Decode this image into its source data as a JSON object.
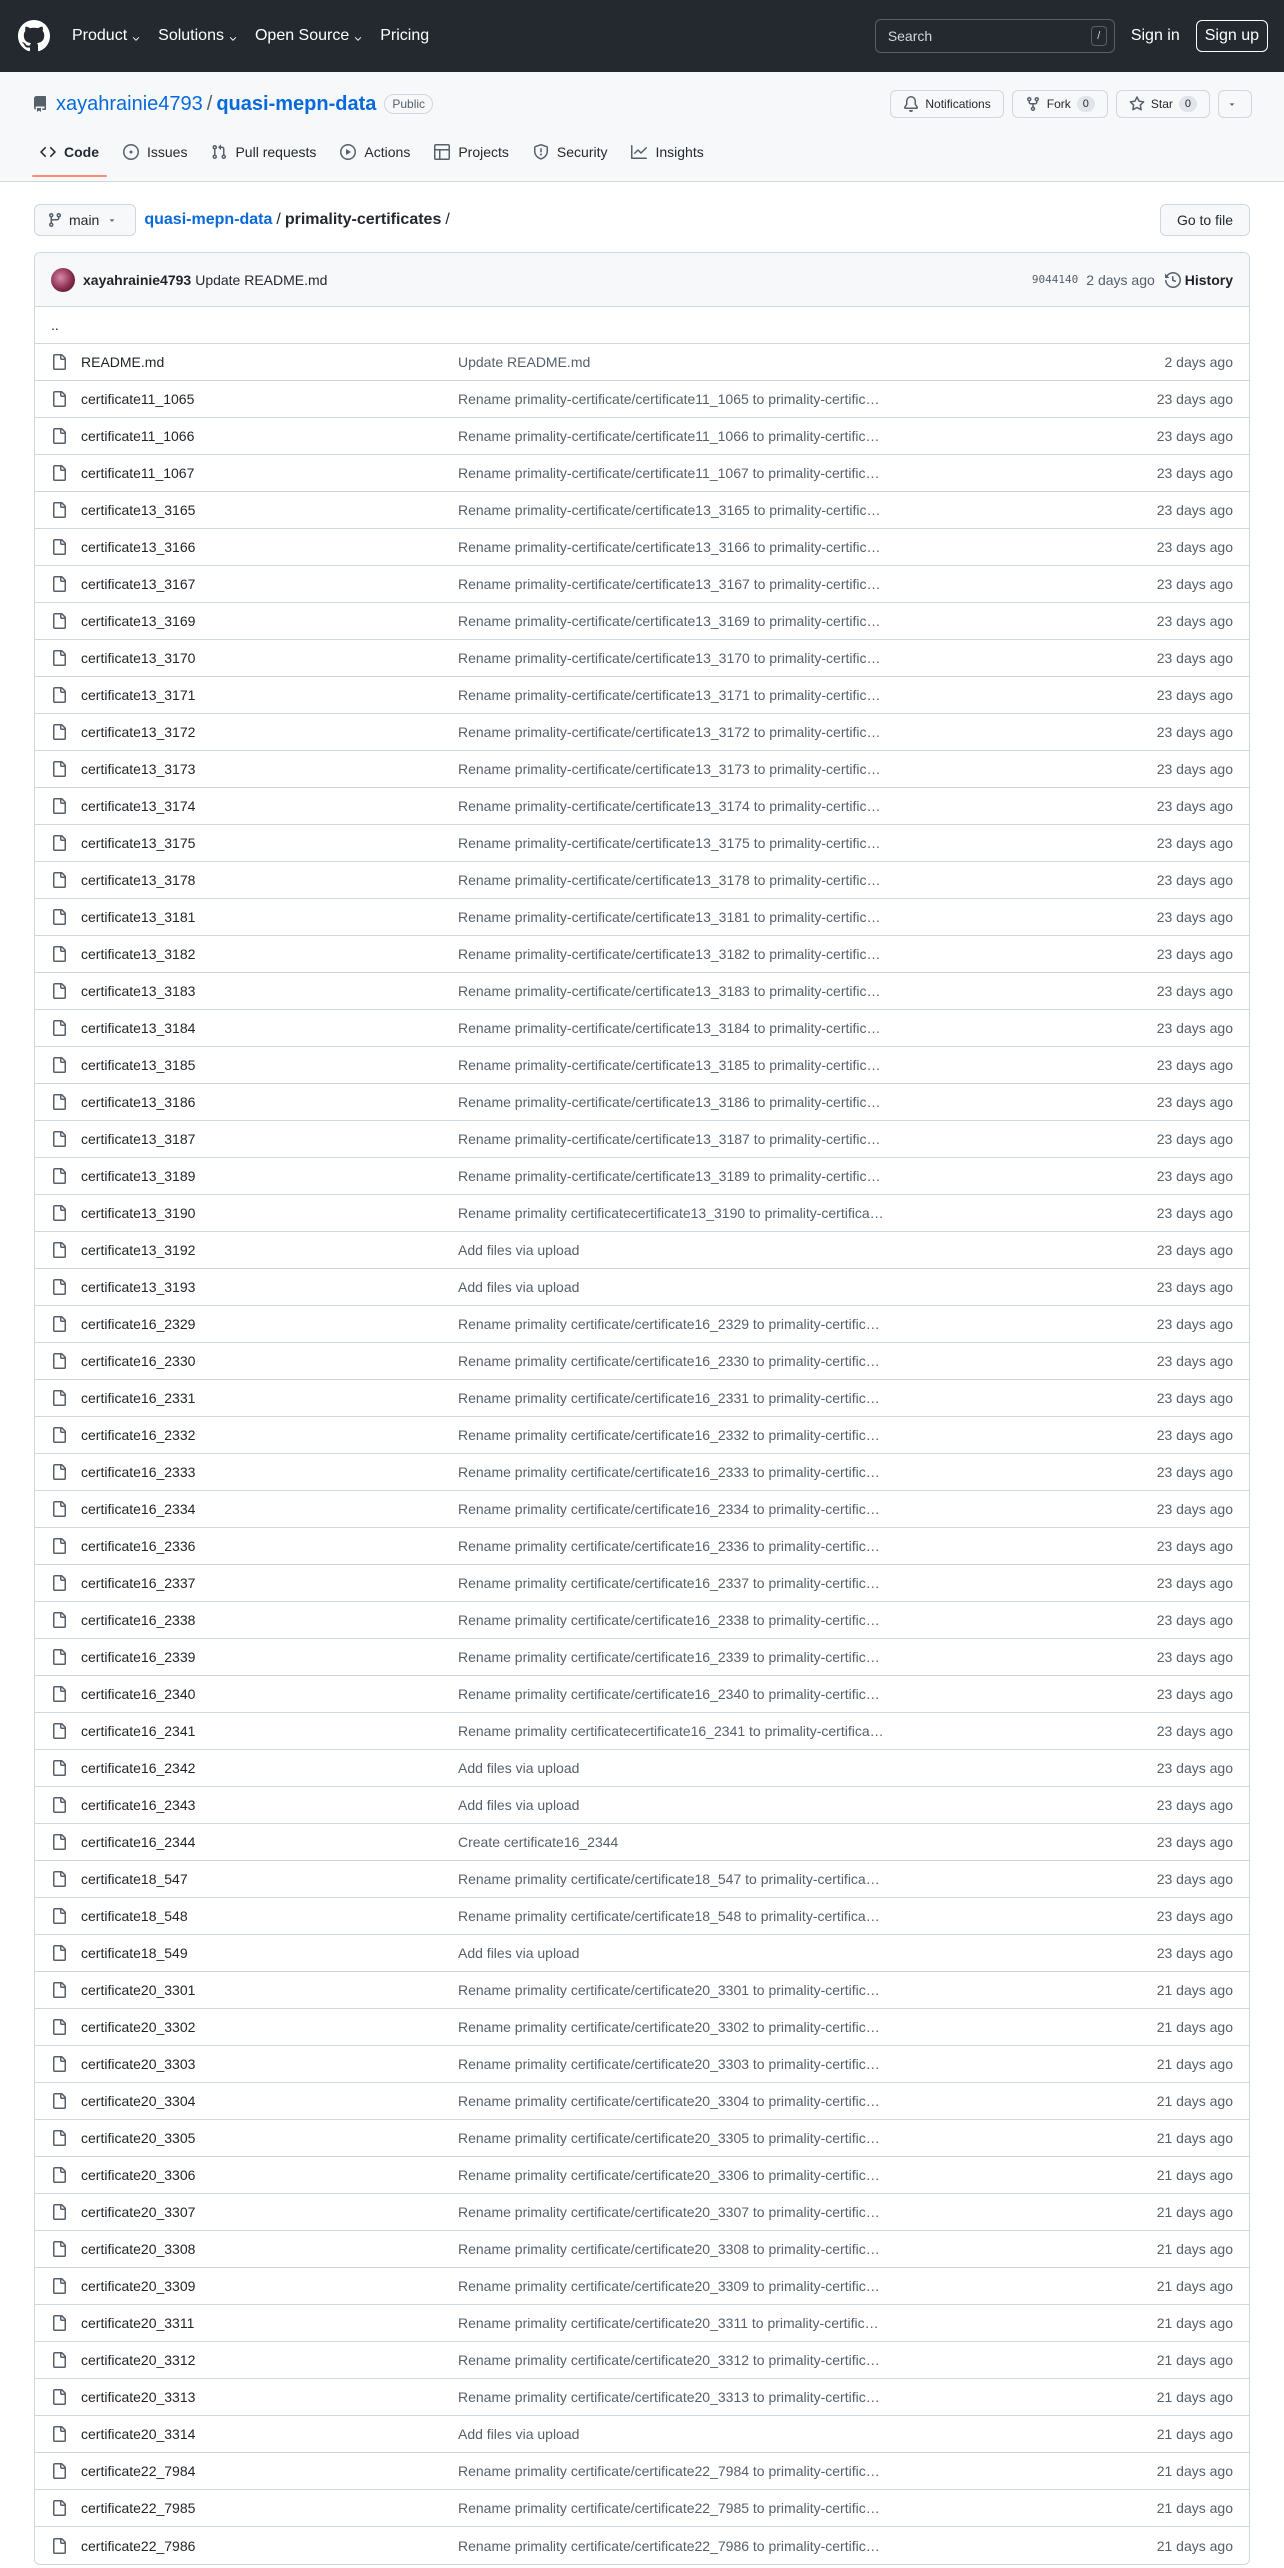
{
  "header": {
    "nav": [
      {
        "label": "Product",
        "dropdown": true
      },
      {
        "label": "Solutions",
        "dropdown": true
      },
      {
        "label": "Open Source",
        "dropdown": true
      },
      {
        "label": "Pricing",
        "dropdown": false
      }
    ],
    "search_placeholder": "Search",
    "search_shortcut": "/",
    "sign_in": "Sign in",
    "sign_up": "Sign up"
  },
  "repo": {
    "owner": "xayahrainie4793",
    "separator": "/",
    "name": "quasi-mepn-data",
    "visibility": "Public",
    "notifications_label": "Notifications",
    "fork_label": "Fork",
    "fork_count": "0",
    "star_label": "Star",
    "star_count": "0",
    "tabs": [
      {
        "label": "Code",
        "icon": "code-icon",
        "selected": true
      },
      {
        "label": "Issues",
        "icon": "issue-icon",
        "selected": false
      },
      {
        "label": "Pull requests",
        "icon": "pull-request-icon",
        "selected": false
      },
      {
        "label": "Actions",
        "icon": "play-icon",
        "selected": false
      },
      {
        "label": "Projects",
        "icon": "table-icon",
        "selected": false
      },
      {
        "label": "Security",
        "icon": "shield-icon",
        "selected": false
      },
      {
        "label": "Insights",
        "icon": "graph-icon",
        "selected": false
      }
    ]
  },
  "file_nav": {
    "branch": "main",
    "crumb_repo": "quasi-mepn-data",
    "crumb_dir": "primality-certificates",
    "crumb_sep": "/",
    "goto_file": "Go to file"
  },
  "latest_commit": {
    "author": "xayahrainie4793",
    "message": "Update README.md",
    "sha": "9044140",
    "age": "2 days ago",
    "history_label": "History"
  },
  "parent_dir": "..",
  "files": [
    {
      "name": "README.md",
      "message": "Update README.md",
      "age": "2 days ago"
    },
    {
      "name": "certificate11_1065",
      "message": "Rename primality-certificate/certificate11_1065 to primality-certific…",
      "age": "23 days ago"
    },
    {
      "name": "certificate11_1066",
      "message": "Rename primality-certificate/certificate11_1066 to primality-certific…",
      "age": "23 days ago"
    },
    {
      "name": "certificate11_1067",
      "message": "Rename primality-certificate/certificate11_1067 to primality-certific…",
      "age": "23 days ago"
    },
    {
      "name": "certificate13_3165",
      "message": "Rename primality-certificate/certificate13_3165 to primality-certific…",
      "age": "23 days ago"
    },
    {
      "name": "certificate13_3166",
      "message": "Rename primality-certificate/certificate13_3166 to primality-certific…",
      "age": "23 days ago"
    },
    {
      "name": "certificate13_3167",
      "message": "Rename primality-certificate/certificate13_3167 to primality-certific…",
      "age": "23 days ago"
    },
    {
      "name": "certificate13_3169",
      "message": "Rename primality-certificate/certificate13_3169 to primality-certific…",
      "age": "23 days ago"
    },
    {
      "name": "certificate13_3170",
      "message": "Rename primality-certificate/certificate13_3170 to primality-certific…",
      "age": "23 days ago"
    },
    {
      "name": "certificate13_3171",
      "message": "Rename primality-certificate/certificate13_3171 to primality-certific…",
      "age": "23 days ago"
    },
    {
      "name": "certificate13_3172",
      "message": "Rename primality-certificate/certificate13_3172 to primality-certific…",
      "age": "23 days ago"
    },
    {
      "name": "certificate13_3173",
      "message": "Rename primality-certificate/certificate13_3173 to primality-certific…",
      "age": "23 days ago"
    },
    {
      "name": "certificate13_3174",
      "message": "Rename primality-certificate/certificate13_3174 to primality-certific…",
      "age": "23 days ago"
    },
    {
      "name": "certificate13_3175",
      "message": "Rename primality-certificate/certificate13_3175 to primality-certific…",
      "age": "23 days ago"
    },
    {
      "name": "certificate13_3178",
      "message": "Rename primality-certificate/certificate13_3178 to primality-certific…",
      "age": "23 days ago"
    },
    {
      "name": "certificate13_3181",
      "message": "Rename primality-certificate/certificate13_3181 to primality-certific…",
      "age": "23 days ago"
    },
    {
      "name": "certificate13_3182",
      "message": "Rename primality-certificate/certificate13_3182 to primality-certific…",
      "age": "23 days ago"
    },
    {
      "name": "certificate13_3183",
      "message": "Rename primality-certificate/certificate13_3183 to primality-certific…",
      "age": "23 days ago"
    },
    {
      "name": "certificate13_3184",
      "message": "Rename primality-certificate/certificate13_3184 to primality-certific…",
      "age": "23 days ago"
    },
    {
      "name": "certificate13_3185",
      "message": "Rename primality-certificate/certificate13_3185 to primality-certific…",
      "age": "23 days ago"
    },
    {
      "name": "certificate13_3186",
      "message": "Rename primality-certificate/certificate13_3186 to primality-certific…",
      "age": "23 days ago"
    },
    {
      "name": "certificate13_3187",
      "message": "Rename primality-certificate/certificate13_3187 to primality-certific…",
      "age": "23 days ago"
    },
    {
      "name": "certificate13_3189",
      "message": "Rename primality-certificate/certificate13_3189 to primality-certific…",
      "age": "23 days ago"
    },
    {
      "name": "certificate13_3190",
      "message": "Rename primality certificatecertificate13_3190 to primality-certifica…",
      "age": "23 days ago"
    },
    {
      "name": "certificate13_3192",
      "message": "Add files via upload",
      "age": "23 days ago"
    },
    {
      "name": "certificate13_3193",
      "message": "Add files via upload",
      "age": "23 days ago"
    },
    {
      "name": "certificate16_2329",
      "message": "Rename primality certificate/certificate16_2329 to primality-certific…",
      "age": "23 days ago"
    },
    {
      "name": "certificate16_2330",
      "message": "Rename primality certificate/certificate16_2330 to primality-certific…",
      "age": "23 days ago"
    },
    {
      "name": "certificate16_2331",
      "message": "Rename primality certificate/certificate16_2331 to primality-certific…",
      "age": "23 days ago"
    },
    {
      "name": "certificate16_2332",
      "message": "Rename primality certificate/certificate16_2332 to primality-certific…",
      "age": "23 days ago"
    },
    {
      "name": "certificate16_2333",
      "message": "Rename primality certificate/certificate16_2333 to primality-certific…",
      "age": "23 days ago"
    },
    {
      "name": "certificate16_2334",
      "message": "Rename primality certificate/certificate16_2334 to primality-certific…",
      "age": "23 days ago"
    },
    {
      "name": "certificate16_2336",
      "message": "Rename primality certificate/certificate16_2336 to primality-certific…",
      "age": "23 days ago"
    },
    {
      "name": "certificate16_2337",
      "message": "Rename primality certificate/certificate16_2337 to primality-certific…",
      "age": "23 days ago"
    },
    {
      "name": "certificate16_2338",
      "message": "Rename primality certificate/certificate16_2338 to primality-certific…",
      "age": "23 days ago"
    },
    {
      "name": "certificate16_2339",
      "message": "Rename primality certificate/certificate16_2339 to primality-certific…",
      "age": "23 days ago"
    },
    {
      "name": "certificate16_2340",
      "message": "Rename primality certificate/certificate16_2340 to primality-certific…",
      "age": "23 days ago"
    },
    {
      "name": "certificate16_2341",
      "message": "Rename primality certificatecertificate16_2341 to primality-certifica…",
      "age": "23 days ago"
    },
    {
      "name": "certificate16_2342",
      "message": "Add files via upload",
      "age": "23 days ago"
    },
    {
      "name": "certificate16_2343",
      "message": "Add files via upload",
      "age": "23 days ago"
    },
    {
      "name": "certificate16_2344",
      "message": "Create certificate16_2344",
      "age": "23 days ago"
    },
    {
      "name": "certificate18_547",
      "message": "Rename primality certificate/certificate18_547 to primality-certifica…",
      "age": "23 days ago"
    },
    {
      "name": "certificate18_548",
      "message": "Rename primality certificate/certificate18_548 to primality-certifica…",
      "age": "23 days ago"
    },
    {
      "name": "certificate18_549",
      "message": "Add files via upload",
      "age": "23 days ago"
    },
    {
      "name": "certificate20_3301",
      "message": "Rename primality certificate/certificate20_3301 to primality-certific…",
      "age": "21 days ago"
    },
    {
      "name": "certificate20_3302",
      "message": "Rename primality certificate/certificate20_3302 to primality-certific…",
      "age": "21 days ago"
    },
    {
      "name": "certificate20_3303",
      "message": "Rename primality certificate/certificate20_3303 to primality-certific…",
      "age": "21 days ago"
    },
    {
      "name": "certificate20_3304",
      "message": "Rename primality certificate/certificate20_3304 to primality-certific…",
      "age": "21 days ago"
    },
    {
      "name": "certificate20_3305",
      "message": "Rename primality certificate/certificate20_3305 to primality-certific…",
      "age": "21 days ago"
    },
    {
      "name": "certificate20_3306",
      "message": "Rename primality certificate/certificate20_3306 to primality-certific…",
      "age": "21 days ago"
    },
    {
      "name": "certificate20_3307",
      "message": "Rename primality certificate/certificate20_3307 to primality-certific…",
      "age": "21 days ago"
    },
    {
      "name": "certificate20_3308",
      "message": "Rename primality certificate/certificate20_3308 to primality-certific…",
      "age": "21 days ago"
    },
    {
      "name": "certificate20_3309",
      "message": "Rename primality certificate/certificate20_3309 to primality-certific…",
      "age": "21 days ago"
    },
    {
      "name": "certificate20_3311",
      "message": "Rename primality certificate/certificate20_3311 to primality-certific…",
      "age": "21 days ago"
    },
    {
      "name": "certificate20_3312",
      "message": "Rename primality certificate/certificate20_3312 to primality-certific…",
      "age": "21 days ago"
    },
    {
      "name": "certificate20_3313",
      "message": "Rename primality certificate/certificate20_3313 to primality-certific…",
      "age": "21 days ago"
    },
    {
      "name": "certificate20_3314",
      "message": "Add files via upload",
      "age": "21 days ago"
    },
    {
      "name": "certificate22_7984",
      "message": "Rename primality certificate/certificate22_7984 to primality-certific…",
      "age": "21 days ago"
    },
    {
      "name": "certificate22_7985",
      "message": "Rename primality certificate/certificate22_7985 to primality-certific…",
      "age": "21 days ago"
    },
    {
      "name": "certificate22_7986",
      "message": "Rename primality certificate/certificate22_7986 to primality-certific…",
      "age": "21 days ago"
    }
  ]
}
